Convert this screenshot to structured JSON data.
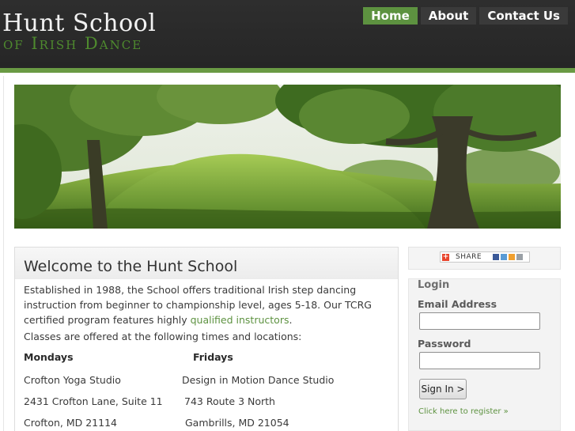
{
  "header": {
    "logo_line1": "Hunt School",
    "logo_line2": "of Irish Dance",
    "nav": [
      {
        "label": "Home",
        "active": true
      },
      {
        "label": "About",
        "active": false
      },
      {
        "label": "Contact Us",
        "active": false
      }
    ]
  },
  "colors": {
    "accent": "#5d9240",
    "header_bg": "#2b2b2b",
    "logo_green": "#4e8a2e"
  },
  "main": {
    "title": "Welcome to the Hunt School",
    "intro_text": "Established in 1988, the School offers traditional Irish step dancing instruction from beginner to championship level, ages 5-18. Our TCRG certified program features highly ",
    "intro_link": "qualified instructors",
    "intro_end": ".",
    "classes_text": "Classes are offered at the following times and locations:",
    "schedule": {
      "col1_head": "Mondays",
      "col2_head": "Fridays",
      "col1": [
        "Crofton Yoga Studio",
        "2431 Crofton Lane, Suite 11",
        "Crofton, MD 21114"
      ],
      "col2": [
        "Design in Motion Dance Studio",
        "743 Route 3 North",
        "Gambrills, MD 21054"
      ]
    }
  },
  "sidebar": {
    "share_label": "SHARE",
    "login": {
      "title": "Login",
      "email_label": "Email Address",
      "email_value": "",
      "password_label": "Password",
      "password_value": "",
      "signin_label": "Sign In >",
      "register_link": "Click here to register »"
    }
  }
}
